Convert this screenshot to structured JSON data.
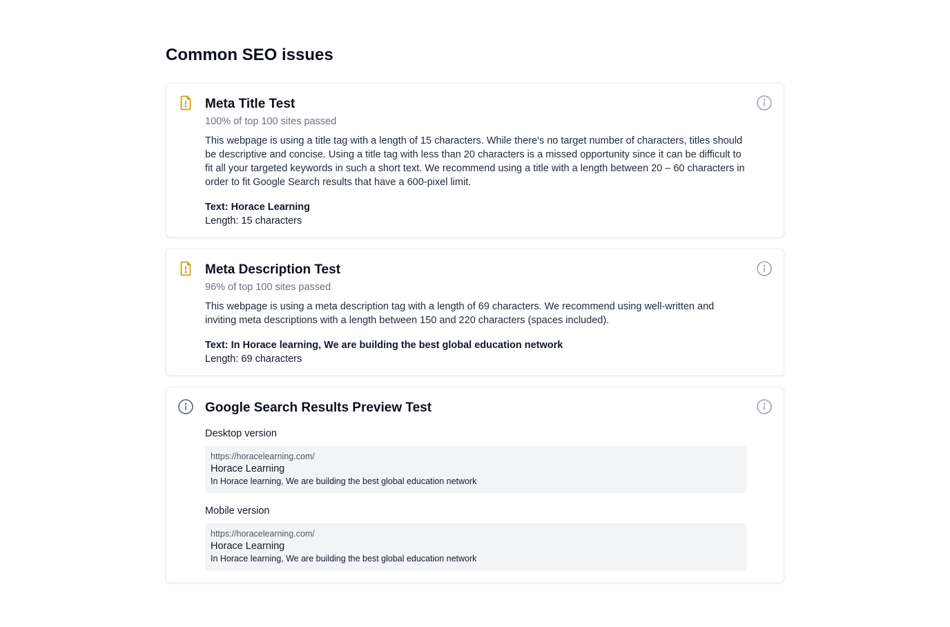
{
  "page": {
    "title": "Common SEO issues"
  },
  "colors": {
    "warning": "#d4a20a",
    "info_gray": "#9ca3af",
    "info_dark": "#6b7280"
  },
  "cards": [
    {
      "status_icon": "document-warning-icon",
      "title": "Meta Title Test",
      "subtitle": "100% of top 100 sites passed",
      "description": "This webpage is using a title tag with a length of 15 characters. While there's no target number of characters, titles should be descriptive and concise. Using a title tag with less than 20 characters is a missed opportunity since it can be difficult to fit all your targeted keywords in such a short text. We recommend using a title with a length between 20 – 60 characters in order to fit Google Search results that have a 600-pixel limit.",
      "text_line": "Text: Horace Learning",
      "length_line": "Length: 15 characters",
      "info_icon": "info-icon"
    },
    {
      "status_icon": "document-warning-icon",
      "title": "Meta Description Test",
      "subtitle": "96% of top 100 sites passed",
      "description": "This webpage is using a meta description tag with a length of 69 characters. We recommend using well-written and inviting meta descriptions with a length between 150 and 220 characters (spaces included).",
      "text_line": "Text: In Horace learning, We are building the best global education network",
      "length_line": "Length: 69 characters",
      "info_icon": "info-icon"
    },
    {
      "status_icon": "info-icon",
      "title": "Google Search Results Preview Test",
      "info_icon": "info-icon",
      "desktop": {
        "label": "Desktop version",
        "url": "https://horacelearning.com/",
        "title": "Horace Learning",
        "description": "In Horace learning, We are building the best global education network"
      },
      "mobile": {
        "label": "Mobile version",
        "url": "https://horacelearning.com/",
        "title": "Horace Learning",
        "description": "In Horace learning, We are building the best global education network"
      }
    }
  ]
}
